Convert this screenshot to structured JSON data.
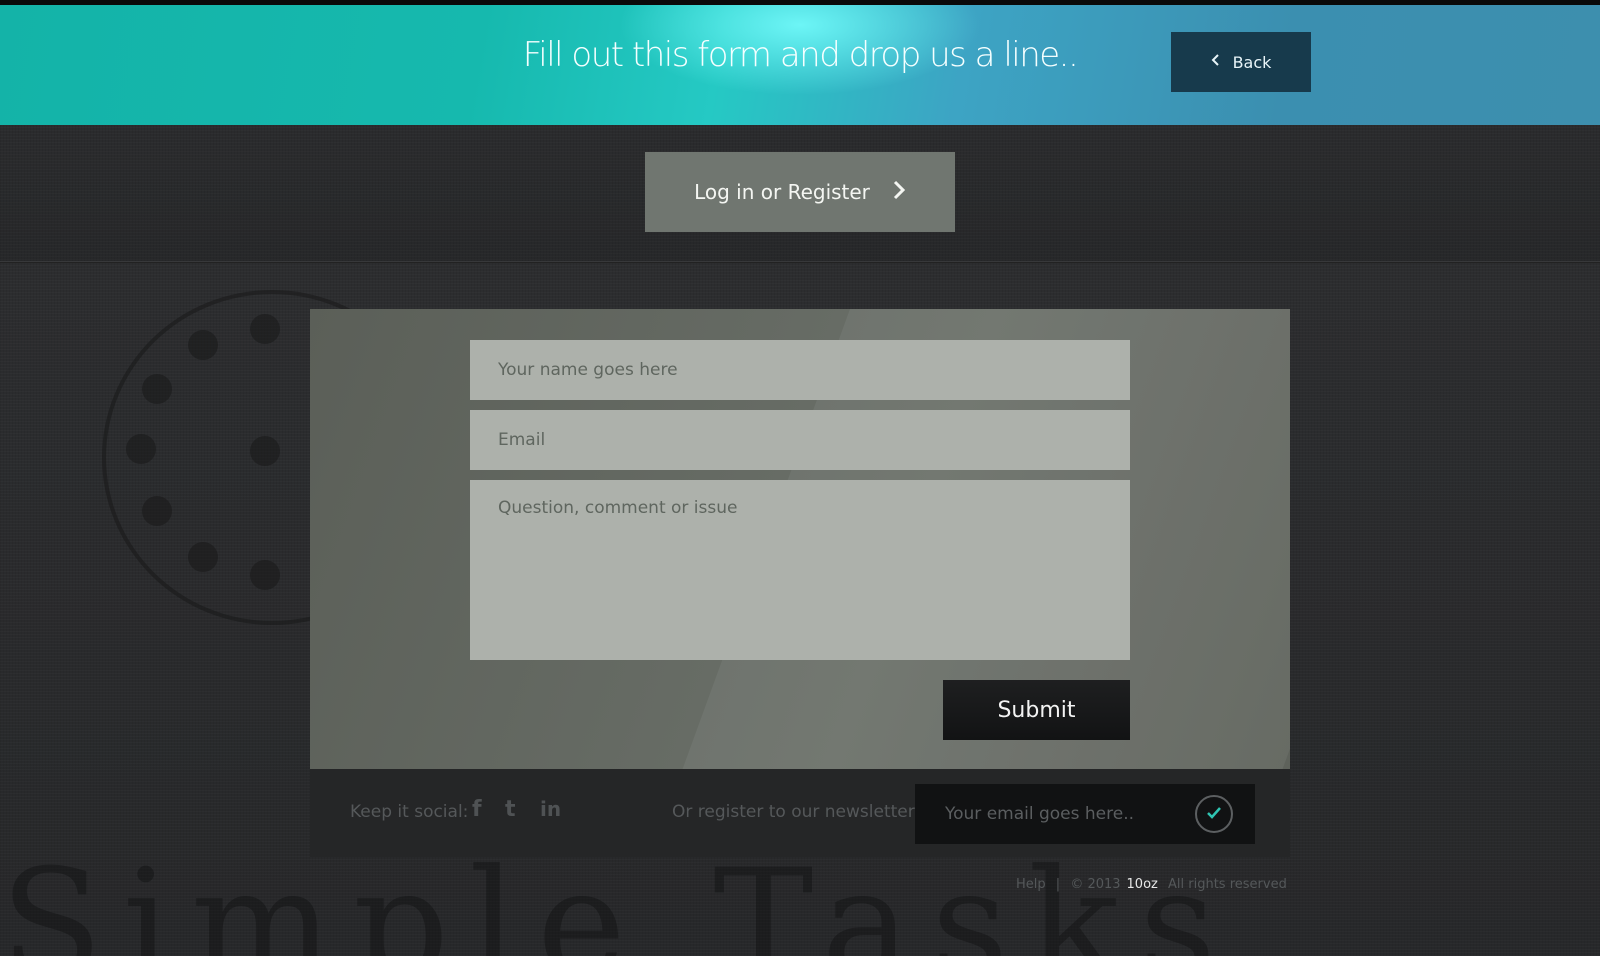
{
  "header": {
    "title": "Fill out this form and drop us a line..",
    "back_label": "Back"
  },
  "login": {
    "label": "Log in or Register"
  },
  "form": {
    "name_placeholder": "Your name goes here",
    "email_placeholder": "Email",
    "message_placeholder": "Question, comment or issue",
    "submit_label": "Submit"
  },
  "footer": {
    "social_label": "Keep it social:",
    "social_icons": [
      "facebook-icon",
      "twitter-icon",
      "linkedin-icon"
    ],
    "newsletter_label": "Or register to our newsletter:",
    "newsletter_placeholder": "Your email goes here.."
  },
  "bottom": {
    "help": "Help",
    "separator": "|",
    "copyright": "© 2013",
    "brand": "10oz",
    "rights": "All rights reserved"
  },
  "colors": {
    "header_teal": "#16b9ae",
    "header_blue": "#3b8fb0",
    "back_button": "#173a4c",
    "login_button": "#707670",
    "form_panel": "#656a63",
    "field_bg": "#adb1ab",
    "submit_bg": "#1e1f20",
    "check_accent": "#2fc4b2"
  }
}
